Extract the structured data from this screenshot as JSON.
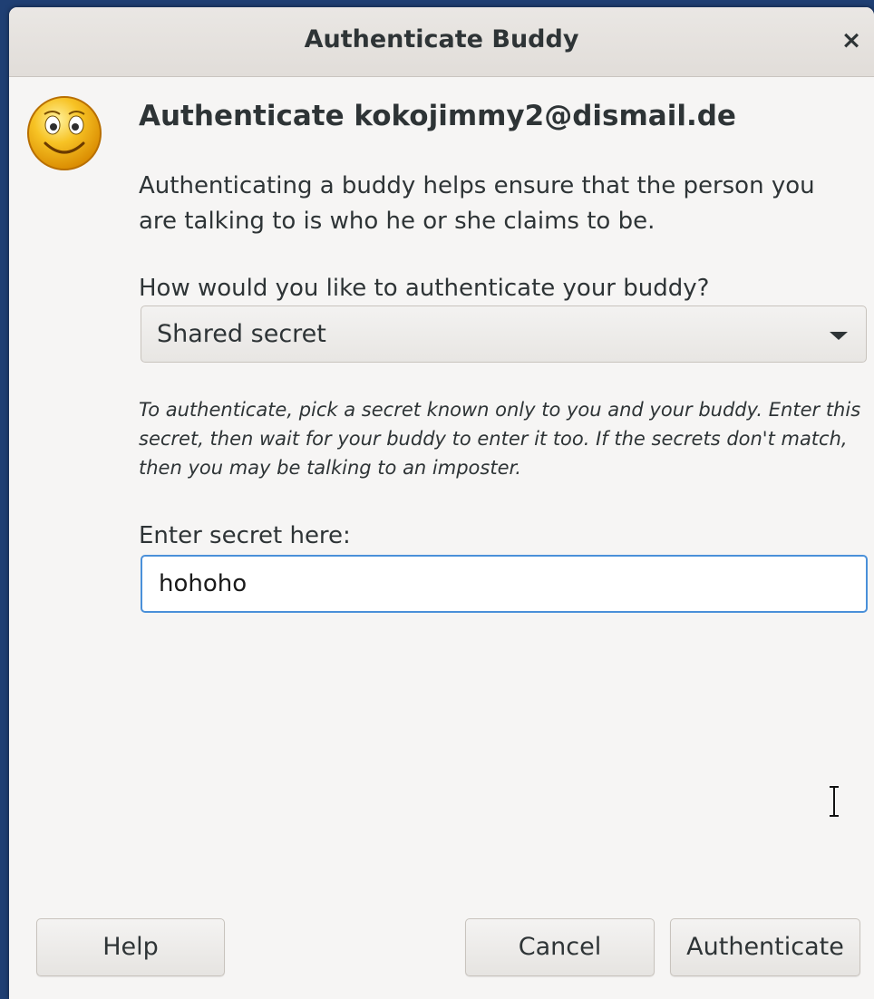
{
  "window": {
    "title": "Authenticate Buddy",
    "close_icon": "close-icon"
  },
  "header": {
    "icon": "smiley-face-icon",
    "heading": "Authenticate kokojimmy2@dismail.de"
  },
  "body": {
    "description": "Authenticating a buddy helps ensure that the person you are talking to is who he or she claims to be.",
    "question": "How would you like to authenticate your buddy?",
    "method_select": {
      "selected": "Shared secret",
      "icon": "chevron-down-icon"
    },
    "hint": "To authenticate, pick a secret known only to you and your buddy.  Enter this secret, then wait for your buddy to enter it too.  If the secrets don't match, then you may be talking to an imposter.",
    "secret_label": "Enter secret here:",
    "secret_value": "hohoho"
  },
  "buttons": {
    "help": "Help",
    "cancel": "Cancel",
    "authenticate": "Authenticate"
  },
  "colors": {
    "desktop_background": "#1f3f73",
    "dialog_background": "#f6f5f4",
    "focus_border": "#4a90d9",
    "text": "#2e3436"
  }
}
